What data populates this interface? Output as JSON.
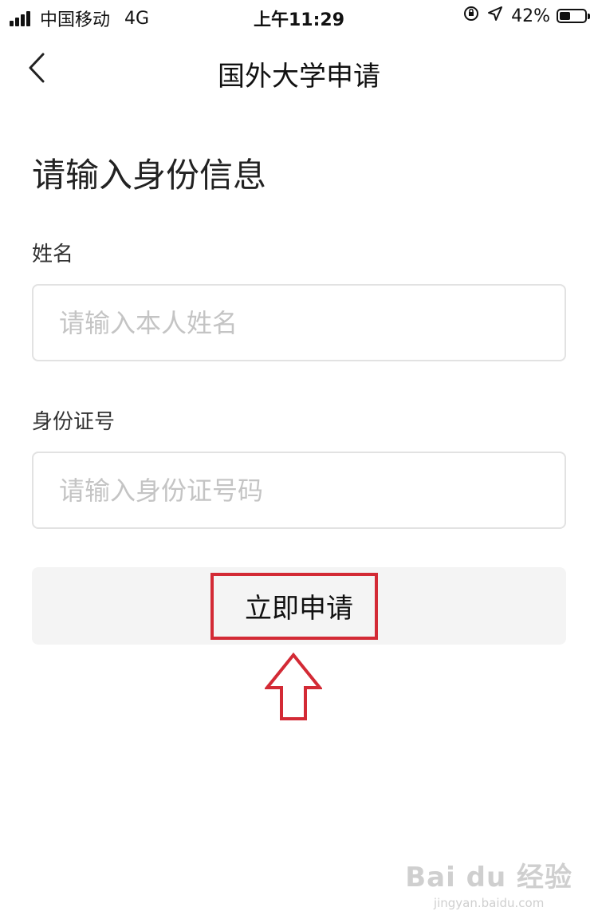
{
  "status_bar": {
    "carrier": "中国移动",
    "network": "4G",
    "time": "上午11:29",
    "battery": "42%",
    "battery_level": 0.42
  },
  "nav": {
    "title": "国外大学申请",
    "back_icon": "chevron-left-icon"
  },
  "form": {
    "heading": "请输入身份信息",
    "name_label": "姓名",
    "name_placeholder": "请输入本人姓名",
    "id_label": "身份证号",
    "id_placeholder": "请输入身份证号码",
    "submit_label": "立即申请"
  },
  "annotation": {
    "highlight_color": "#d32a35",
    "arrow_icon": "up-arrow-icon"
  },
  "watermark": {
    "main": "Bai du 经验",
    "sub": "jingyan.baidu.com"
  }
}
